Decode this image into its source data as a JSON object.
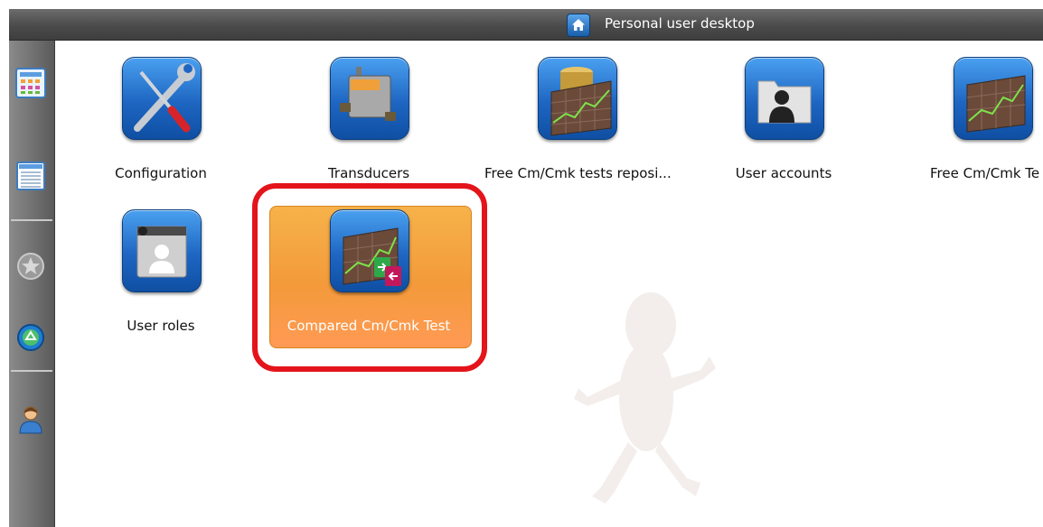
{
  "titlebar": {
    "title": "Personal user desktop",
    "icon": "home-icon"
  },
  "sidebar": {
    "items": [
      {
        "icon": "grid-view-icon"
      },
      {
        "icon": "list-view-icon"
      },
      {
        "icon": "favorites-star-icon"
      },
      {
        "icon": "recycle-icon"
      },
      {
        "icon": "user-profile-icon"
      }
    ]
  },
  "desktop": {
    "items": [
      {
        "label": "Configuration",
        "icon": "tools-icon"
      },
      {
        "label": "Transducers",
        "icon": "transducer-icon"
      },
      {
        "label": "Free Cm/Cmk tests reposi...",
        "icon": "database-chart-icon"
      },
      {
        "label": "User accounts",
        "icon": "user-folder-icon"
      },
      {
        "label": "Free Cm/Cmk Te",
        "icon": "chart-icon"
      },
      {
        "label": "User roles",
        "icon": "user-role-icon"
      },
      {
        "label": "Compared Cm/Cmk Test",
        "icon": "compare-chart-icon",
        "selected": true
      }
    ]
  }
}
